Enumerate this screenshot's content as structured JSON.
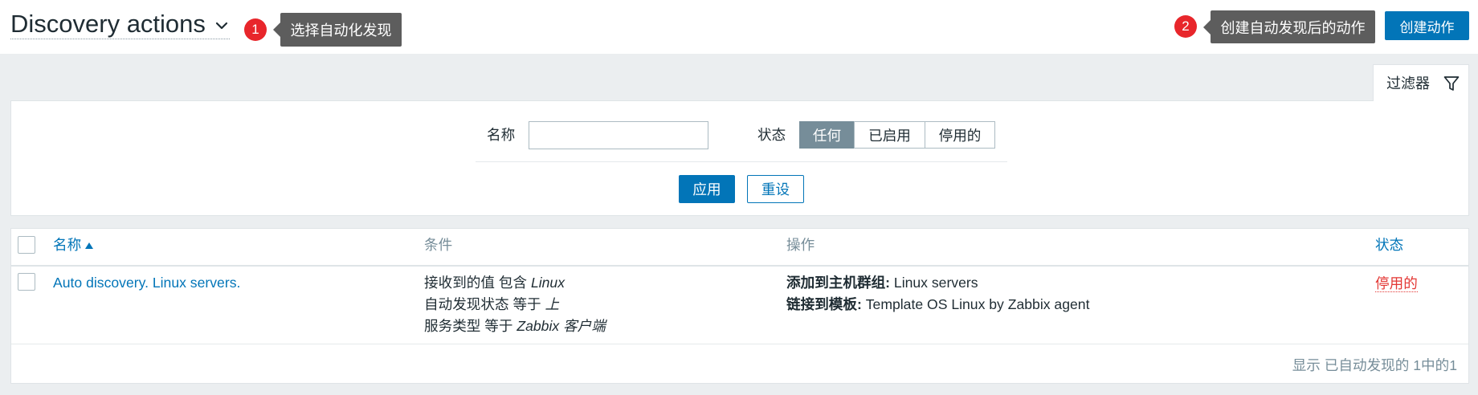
{
  "header": {
    "title": "Discovery actions",
    "create_button": "创建动作"
  },
  "callouts": [
    {
      "number": "1",
      "text": "选择自动化发现"
    },
    {
      "number": "2",
      "text": "创建自动发现后的动作"
    }
  ],
  "filter": {
    "tab_label": "过滤器",
    "name_label": "名称",
    "name_value": "",
    "status_label": "状态",
    "status_options": [
      {
        "label": "任何",
        "selected": true
      },
      {
        "label": "已启用",
        "selected": false
      },
      {
        "label": "停用的",
        "selected": false
      }
    ],
    "apply_button": "应用",
    "reset_button": "重设"
  },
  "table": {
    "columns": {
      "name": "名称",
      "conditions": "条件",
      "operations": "操作",
      "status": "状态"
    },
    "rows": [
      {
        "name": "Auto discovery. Linux servers.",
        "checked": false,
        "conditions": [
          {
            "text": "接收到的值 包含",
            "value": "Linux"
          },
          {
            "text": "自动发现状态 等于",
            "value": "上"
          },
          {
            "text": "服务类型 等于",
            "value": "Zabbix 客户端"
          }
        ],
        "operations": [
          {
            "label": "添加到主机群组:",
            "value": "Linux servers"
          },
          {
            "label": "链接到模板:",
            "value": "Template OS Linux by Zabbix agent"
          }
        ],
        "status": "停用的"
      }
    ],
    "footer": "显示 已自动发现的 1中的1"
  },
  "icons": {
    "title_dropdown": "chevron-down-icon",
    "filter": "filter-icon",
    "sort_indicator": "sort-ascending-icon",
    "select_all": "checkbox-icon"
  },
  "colors": {
    "accent": "#0275b8",
    "danger": "#e33734",
    "badge": "#e8262b",
    "tip": "#5d5d5d",
    "seg": "#768d99",
    "muted": "#768d99",
    "border": "#dfe4e7"
  }
}
